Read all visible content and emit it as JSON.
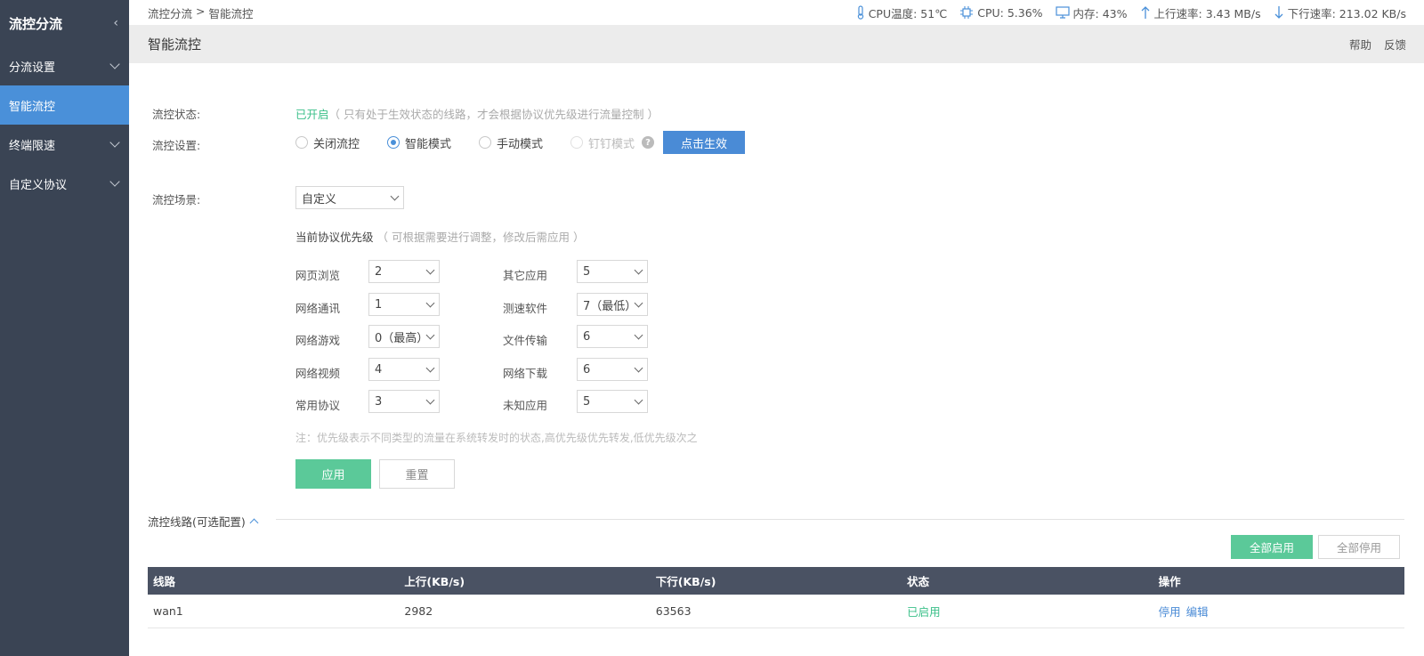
{
  "sidebar": {
    "title": "流控分流",
    "items": [
      {
        "label": "分流设置"
      },
      {
        "label": "智能流控"
      },
      {
        "label": "终端限速"
      },
      {
        "label": "自定义协议"
      }
    ]
  },
  "topbar": {
    "crumb_parent": "流控分流",
    "crumb_sep": ">",
    "crumb_current": "智能流控",
    "cpu_temp": "CPU温度: 51℃",
    "cpu": "CPU: 5.36%",
    "memory": "内存: 43%",
    "upload": "上行速率: 3.43 MB/s",
    "download": "下行速率: 213.02 KB/s"
  },
  "header": {
    "title": "智能流控",
    "help": "帮助",
    "feedback": "反馈"
  },
  "form": {
    "status_label": "流控状态:",
    "status_value": "已开启",
    "status_hint": "（ 只有处于生效状态的线路，才会根据协议优先级进行流量控制 ）",
    "settings_label": "流控设置:",
    "mode_off": "关闭流控",
    "mode_smart": "智能模式",
    "mode_manual": "手动模式",
    "mode_dingtalk": "钉钉模式",
    "qmark": "?",
    "apply_mode_button": "点击生效",
    "scene_label": "流控场景:",
    "scene_value": "自定义",
    "priority_title": "当前协议优先级",
    "priority_hint": "（ 可根据需要进行调整，修改后需应用 ）",
    "protocols_left": [
      {
        "name": "网页浏览",
        "value": "2"
      },
      {
        "name": "网络通讯",
        "value": "1"
      },
      {
        "name": "网络游戏",
        "value": "0（最高）"
      },
      {
        "name": "网络视频",
        "value": "4"
      },
      {
        "name": "常用协议",
        "value": "3"
      }
    ],
    "protocols_right": [
      {
        "name": "其它应用",
        "value": "5"
      },
      {
        "name": "测速软件",
        "value": "7（最低）"
      },
      {
        "name": "文件传输",
        "value": "6"
      },
      {
        "name": "网络下载",
        "value": "6"
      },
      {
        "name": "未知应用",
        "value": "5"
      }
    ],
    "note": "注：优先级表示不同类型的流量在系统转发时的状态,高优先级优先转发,低优先级次之",
    "apply_button": "应用",
    "reset_button": "重置"
  },
  "lines": {
    "section_title": "流控线路(可选配置)",
    "enable_all": "全部启用",
    "disable_all": "全部停用",
    "columns": [
      "线路",
      "上行(KB/s)",
      "下行(KB/s)",
      "状态",
      "操作"
    ],
    "rows": [
      {
        "line": "wan1",
        "up": "2982",
        "down": "63563",
        "status": "已启用",
        "action_stop": "停用",
        "action_edit": "编辑"
      }
    ]
  }
}
